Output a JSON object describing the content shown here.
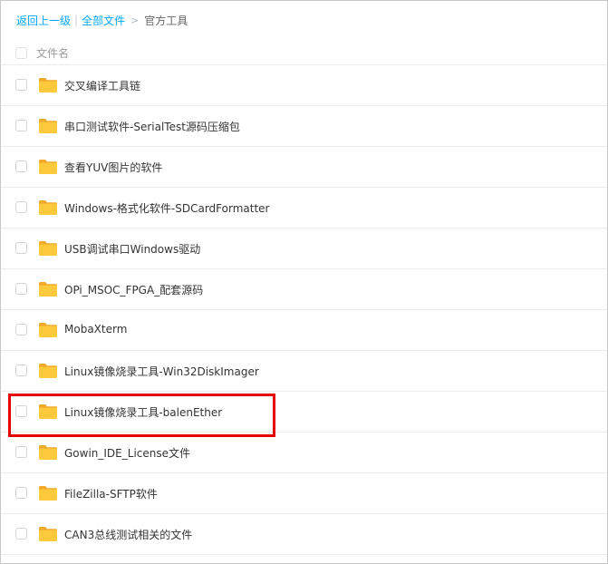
{
  "breadcrumb": {
    "back_label": "返回上一级",
    "separator": "|",
    "all_files_label": "全部文件",
    "arrow": ">",
    "current_label": "官方工具"
  },
  "list_header": {
    "name_column": "文件名"
  },
  "accent_color": "#06a7ff",
  "folder_color": "#ffc93c",
  "highlight_color": "#e60000",
  "folders": [
    {
      "name": "交叉编译工具链",
      "icon": "folder-icon"
    },
    {
      "name": "串口测试软件-SerialTest源码压缩包",
      "icon": "folder-icon"
    },
    {
      "name": "查看YUV图片的软件",
      "icon": "folder-icon"
    },
    {
      "name": "Windows-格式化软件-SDCardFormatter",
      "icon": "folder-icon"
    },
    {
      "name": "USB调试串口Windows驱动",
      "icon": "folder-icon"
    },
    {
      "name": "OPi_MSOC_FPGA_配套源码",
      "icon": "folder-icon"
    },
    {
      "name": "MobaXterm",
      "icon": "folder-icon"
    },
    {
      "name": "Linux镜像烧录工具-Win32DiskImager",
      "icon": "folder-icon"
    },
    {
      "name": "Linux镜像烧录工具-balenEther",
      "icon": "folder-icon",
      "highlighted": true
    },
    {
      "name": "Gowin_IDE_License文件",
      "icon": "folder-icon"
    },
    {
      "name": "FileZilla-SFTP软件",
      "icon": "folder-icon"
    },
    {
      "name": "CAN3总线测试相关的文件",
      "icon": "folder-icon"
    }
  ]
}
